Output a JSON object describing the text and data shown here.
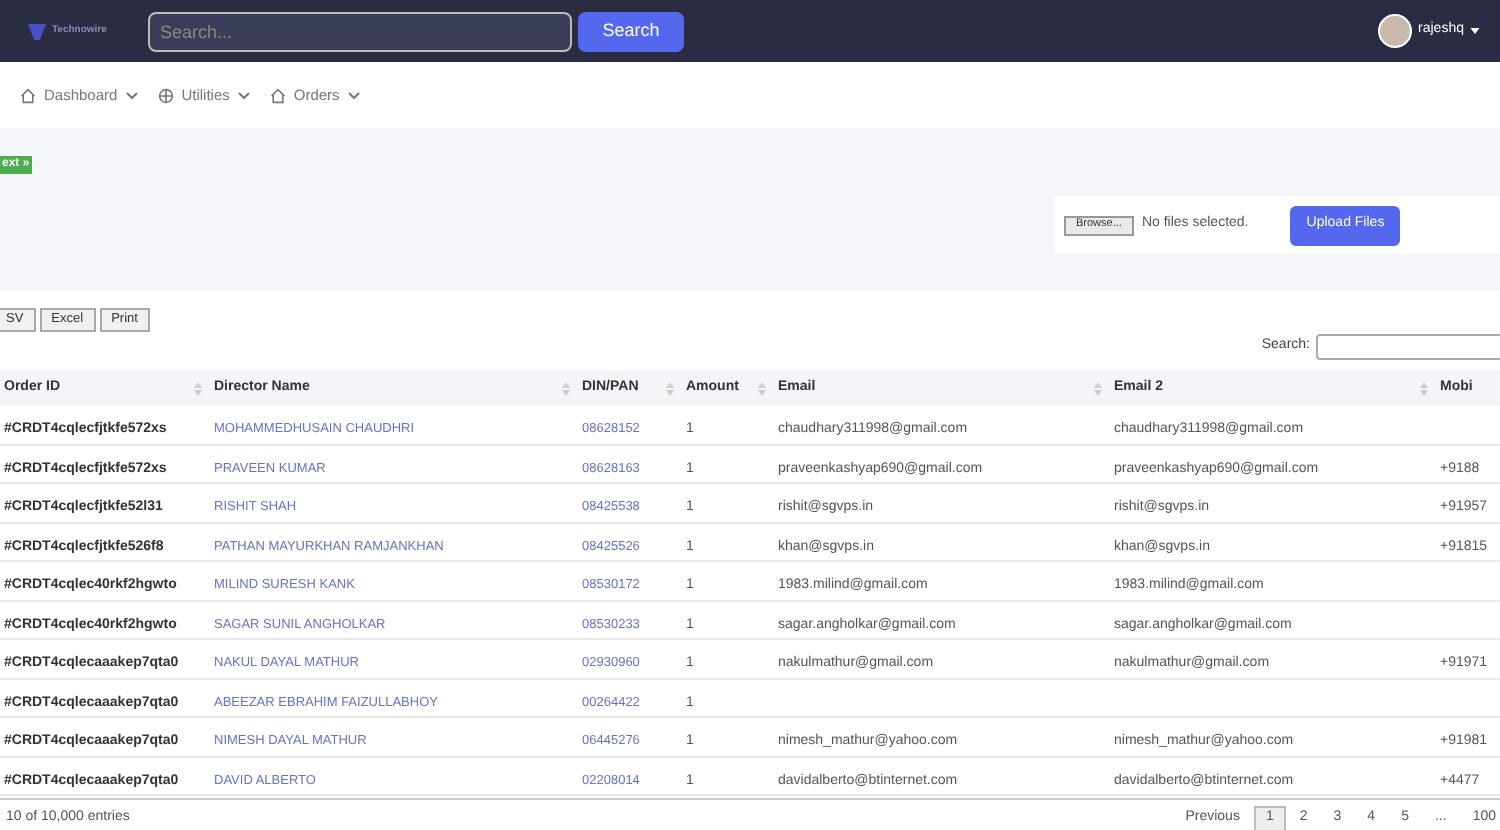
{
  "navbar": {
    "brand": "Technowire",
    "search": {
      "placeholder": "Search..."
    },
    "search_button": "Search",
    "user": "rajeshq"
  },
  "menu": [
    {
      "label": "Dashboard",
      "kind": "home"
    },
    {
      "label": "Utilities",
      "kind": "globe"
    },
    {
      "label": "Orders",
      "kind": "home"
    }
  ],
  "next_badge": "ext »",
  "upload": {
    "browse": "Browse...",
    "status": "No files selected.",
    "button": "Upload Files"
  },
  "export_buttons": [
    "SV",
    "Excel",
    "Print"
  ],
  "table_search": {
    "label": "Search:"
  },
  "table": {
    "columns": [
      "Order ID",
      "Director Name",
      "DIN/PAN",
      "Amount",
      "Email",
      "Email 2",
      "Mobi"
    ],
    "rows": [
      [
        "#CRDT4cqlecfjtkfe572xs",
        "MOHAMMEDHUSAIN CHAUDHRI",
        "08628152",
        "1",
        "chaudhary311998@gmail.com",
        "chaudhary311998@gmail.com",
        ""
      ],
      [
        "#CRDT4cqlecfjtkfe572xs",
        "PRAVEEN KUMAR",
        "08628163",
        "1",
        "praveenkashyap690@gmail.com",
        "praveenkashyap690@gmail.com",
        "+9188"
      ],
      [
        "#CRDT4cqlecfjtkfe52l31",
        "RISHIT SHAH",
        "08425538",
        "1",
        "rishit@sgvps.in",
        "rishit@sgvps.in",
        "+91957"
      ],
      [
        "#CRDT4cqlecfjtkfe526f8",
        "PATHAN MAYURKHAN RAMJANKHAN",
        "08425526",
        "1",
        "khan@sgvps.in",
        "khan@sgvps.in",
        "+91815"
      ],
      [
        "#CRDT4cqlec40rkf2hgwto",
        "MILIND SURESH KANK",
        "08530172",
        "1",
        "1983.milind@gmail.com",
        "1983.milind@gmail.com",
        ""
      ],
      [
        "#CRDT4cqlec40rkf2hgwto",
        "SAGAR SUNIL ANGHOLKAR",
        "08530233",
        "1",
        "sagar.angholkar@gmail.com",
        "sagar.angholkar@gmail.com",
        ""
      ],
      [
        "#CRDT4cqlecaaakep7qta0",
        "NAKUL DAYAL MATHUR",
        "02930960",
        "1",
        "nakulmathur@gmail.com",
        "nakulmathur@gmail.com",
        "+91971"
      ],
      [
        "#CRDT4cqlecaaakep7qta0",
        "ABEEZAR EBRAHIM FAIZULLABHOY",
        "00264422",
        "1",
        "",
        "",
        ""
      ],
      [
        "#CRDT4cqlecaaakep7qta0",
        "NIMESH DAYAL MATHUR",
        "06445276",
        "1",
        "nimesh_mathur@yahoo.com",
        "nimesh_mathur@yahoo.com",
        "+91981"
      ],
      [
        "#CRDT4cqlecaaakep7qta0",
        "DAVID ALBERTO",
        "02208014",
        "1",
        "davidalberto@btinternet.com",
        "davidalberto@btinternet.com",
        "+4477"
      ]
    ]
  },
  "footer": {
    "info": "10 of 10,000 entries",
    "pagination": [
      {
        "label": "Previous",
        "selected": false
      },
      {
        "label": "1",
        "selected": true
      },
      {
        "label": "2",
        "selected": false
      },
      {
        "label": "3",
        "selected": false
      },
      {
        "label": "4",
        "selected": false
      },
      {
        "label": "5",
        "selected": false
      },
      {
        "label": "...",
        "selected": false
      },
      {
        "label": "100",
        "selected": false
      }
    ]
  }
}
